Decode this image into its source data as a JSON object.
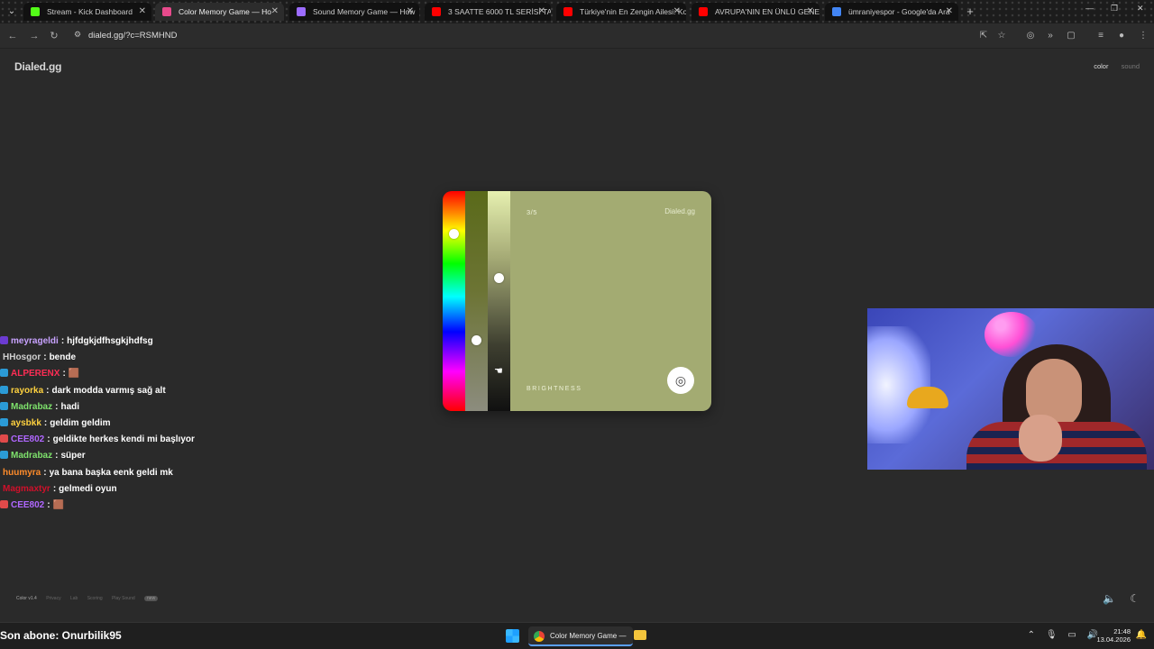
{
  "browser": {
    "tabs": [
      {
        "title": "Stream - Kick Dashboard",
        "favicon_color": "#53fc18",
        "active": false
      },
      {
        "title": "Color Memory Game — Ho",
        "favicon_color": "#e84a8c",
        "active": true
      },
      {
        "title": "Sound Memory Game — How",
        "favicon_color": "#9c6cff",
        "active": false
      },
      {
        "title": "3 SAATTE 6000 TL SERİSİ TARS",
        "favicon_color": "#ff0000",
        "active": false
      },
      {
        "title": "Türkiye'nin En Zengin Ailesi: Ko",
        "favicon_color": "#ff0000",
        "active": false
      },
      {
        "title": "AVRUPA'NIN EN ÜNLÜ GENEL",
        "favicon_color": "#ff0000",
        "active": false
      },
      {
        "title": "ümraniyespor - Google'da Ara",
        "favicon_color": "#4285f4",
        "active": false
      }
    ],
    "url": "dialed.gg/?c=RSMHND"
  },
  "page": {
    "logo": "Dialed.gg",
    "nav": {
      "color": "color",
      "sound": "sound"
    }
  },
  "game": {
    "progress": "3/5",
    "brand": "Dialed.gg",
    "mode_label": "BRIGHTNESS",
    "target_color": "#a3ab72"
  },
  "chat": [
    {
      "user": "meyrageldi",
      "user_color": "#c8a2ff",
      "badge_color": "#6b3bd1",
      "message": "hjfdgkjdfhsgkjhdfsg"
    },
    {
      "user": "HHosgor",
      "user_color": "#d0d0d0",
      "badge_color": "",
      "message": "bende"
    },
    {
      "user": "ALPERENX",
      "user_color": "#ff2d55",
      "badge_color": "#2b9bd6",
      "message": "🟫"
    },
    {
      "user": "rayorka",
      "user_color": "#ffd23f",
      "badge_color": "#2b9bd6",
      "message": "dark modda varmış sağ alt"
    },
    {
      "user": "Madrabaz",
      "user_color": "#7ee26c",
      "badge_color": "#2b9bd6",
      "message": "hadi"
    },
    {
      "user": "aysbkk",
      "user_color": "#ffd23f",
      "badge_color": "#2b9bd6",
      "message": "geldim geldim"
    },
    {
      "user": "CEE802",
      "user_color": "#b067ff",
      "badge_color": "#e04a4a",
      "message": "geldikte herkes kendi mi başlıyor"
    },
    {
      "user": "Madrabaz",
      "user_color": "#7ee26c",
      "badge_color": "#2b9bd6",
      "message": "süper"
    },
    {
      "user": "huumyra",
      "user_color": "#ff8c2a",
      "badge_color": "",
      "message": "ya bana başka eenk geldi mk"
    },
    {
      "user": "Magmaxtyr",
      "user_color": "#d0102a",
      "badge_color": "",
      "message": "gelmedi oyun"
    },
    {
      "user": "CEE802",
      "user_color": "#b067ff",
      "badge_color": "#e04a4a",
      "message": "🟫"
    }
  ],
  "footer": {
    "version": "Color v1.4",
    "links": [
      "Privacy",
      "Lab",
      "Scoring",
      "Play Sound"
    ],
    "new_badge": "new"
  },
  "taskbar": {
    "subscriber": "Son abone: Onurbilik95",
    "app_label": "Color Memory Game —",
    "time": "21:48",
    "date": "13.04.2026"
  }
}
